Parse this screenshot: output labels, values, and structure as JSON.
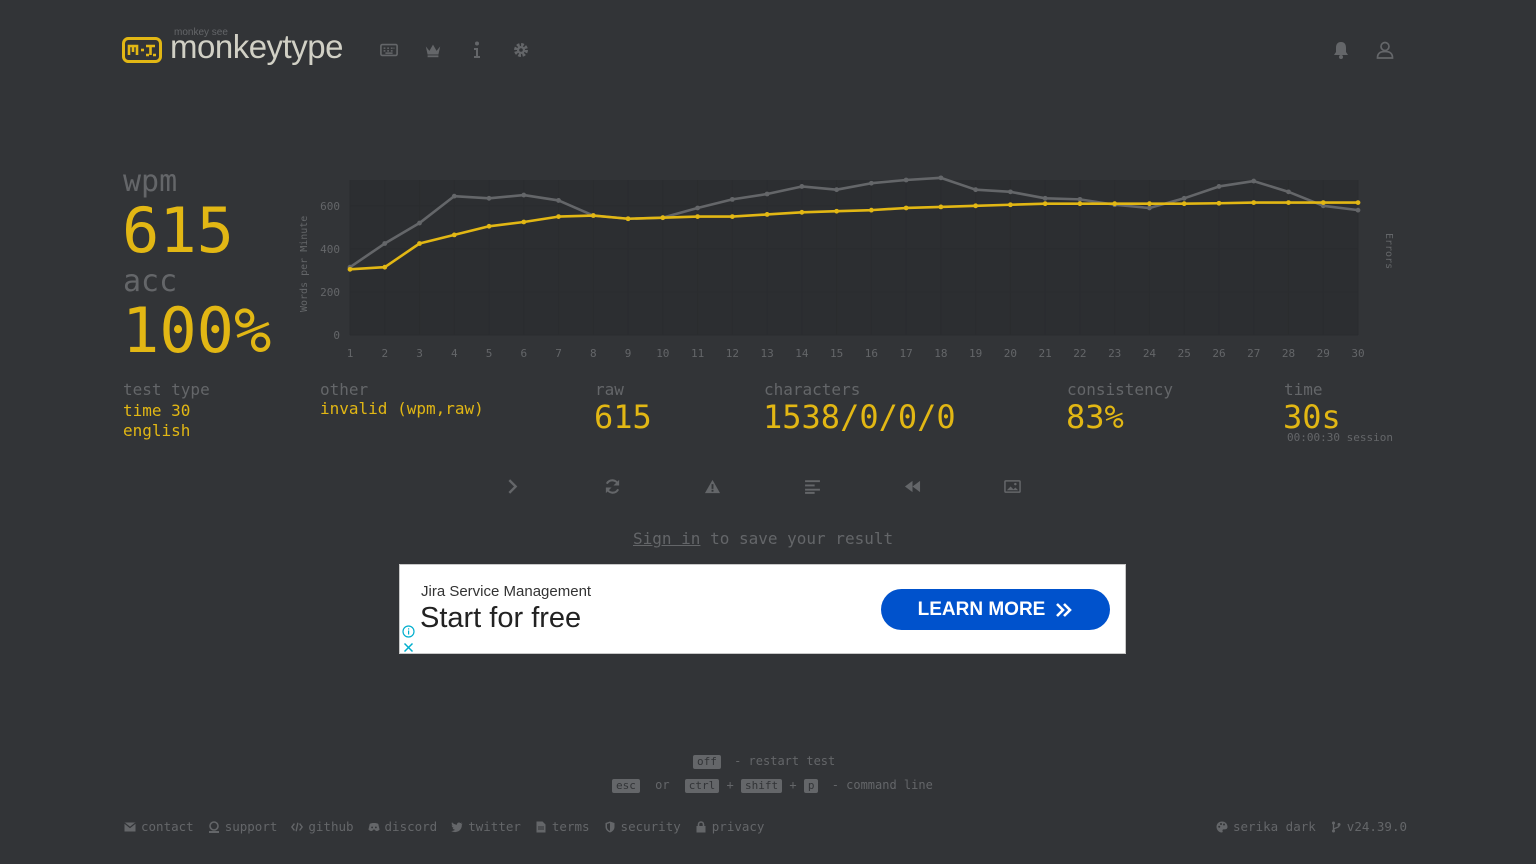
{
  "header": {
    "logo_sub": "monkey see",
    "logo_text": "monkeytype",
    "nav_icons": [
      "keyboard-icon",
      "crown-icon",
      "info-icon",
      "gear-icon"
    ],
    "right_icons": [
      "bell-icon",
      "user-icon"
    ]
  },
  "result": {
    "wpm_label": "wpm",
    "wpm_value": "615",
    "acc_label": "acc",
    "acc_value": "100%",
    "test_type_label": "test type",
    "test_type_line1": "time 30",
    "test_type_line2": "english",
    "other_label": "other",
    "other_value": "invalid (wpm,raw)",
    "raw_label": "raw",
    "raw_value": "615",
    "characters_label": "characters",
    "characters_value": "1538/0/0/0",
    "consistency_label": "consistency",
    "consistency_value": "83%",
    "time_label": "time",
    "time_value": "30s",
    "session_value": "00:00:30 session"
  },
  "actions": [
    "next-test",
    "restart",
    "report",
    "words-history",
    "replay",
    "screenshot"
  ],
  "signin": {
    "link": "Sign in",
    "rest": "to save your result"
  },
  "ad": {
    "brand": "Jira Service Management",
    "headline": "Start for free",
    "cta": "LEARN MORE"
  },
  "hints": {
    "line1_key": "off",
    "line1_text": "- restart test",
    "line2_key1": "esc",
    "line2_or": "or",
    "line2_key2": "ctrl",
    "line2_key3": "shift",
    "line2_key4": "p",
    "line2_plus": "+",
    "line2_text": "- command line"
  },
  "footer": {
    "links": [
      "contact",
      "support",
      "github",
      "discord",
      "twitter",
      "terms",
      "security",
      "privacy"
    ],
    "theme": "serika dark",
    "version": "v24.39.0"
  },
  "colors": {
    "bg": "#323437",
    "main": "#e2b714",
    "sub": "#646669",
    "text": "#d1d0c5"
  },
  "chart_data": {
    "type": "line",
    "ylabel": "Words per Minute",
    "y2label": "Errors",
    "x": [
      1,
      2,
      3,
      4,
      5,
      6,
      7,
      8,
      9,
      10,
      11,
      12,
      13,
      14,
      15,
      16,
      17,
      18,
      19,
      20,
      21,
      22,
      23,
      24,
      25,
      26,
      27,
      28,
      29,
      30
    ],
    "ylim": [
      0,
      720
    ],
    "yticks": [
      0,
      200,
      400,
      600
    ],
    "series": [
      {
        "name": "raw",
        "color": "#646669",
        "values": [
          315,
          425,
          520,
          645,
          635,
          650,
          625,
          555,
          540,
          545,
          590,
          630,
          655,
          690,
          675,
          705,
          720,
          730,
          675,
          665,
          635,
          630,
          605,
          590,
          635,
          690,
          715,
          665,
          600,
          580
        ]
      },
      {
        "name": "wpm",
        "color": "#e2b714",
        "values": [
          305,
          315,
          425,
          465,
          505,
          525,
          550,
          555,
          540,
          545,
          550,
          550,
          560,
          570,
          575,
          580,
          590,
          595,
          600,
          605,
          610,
          610,
          610,
          610,
          610,
          612,
          615,
          615,
          615,
          615
        ]
      }
    ],
    "grid": true
  }
}
